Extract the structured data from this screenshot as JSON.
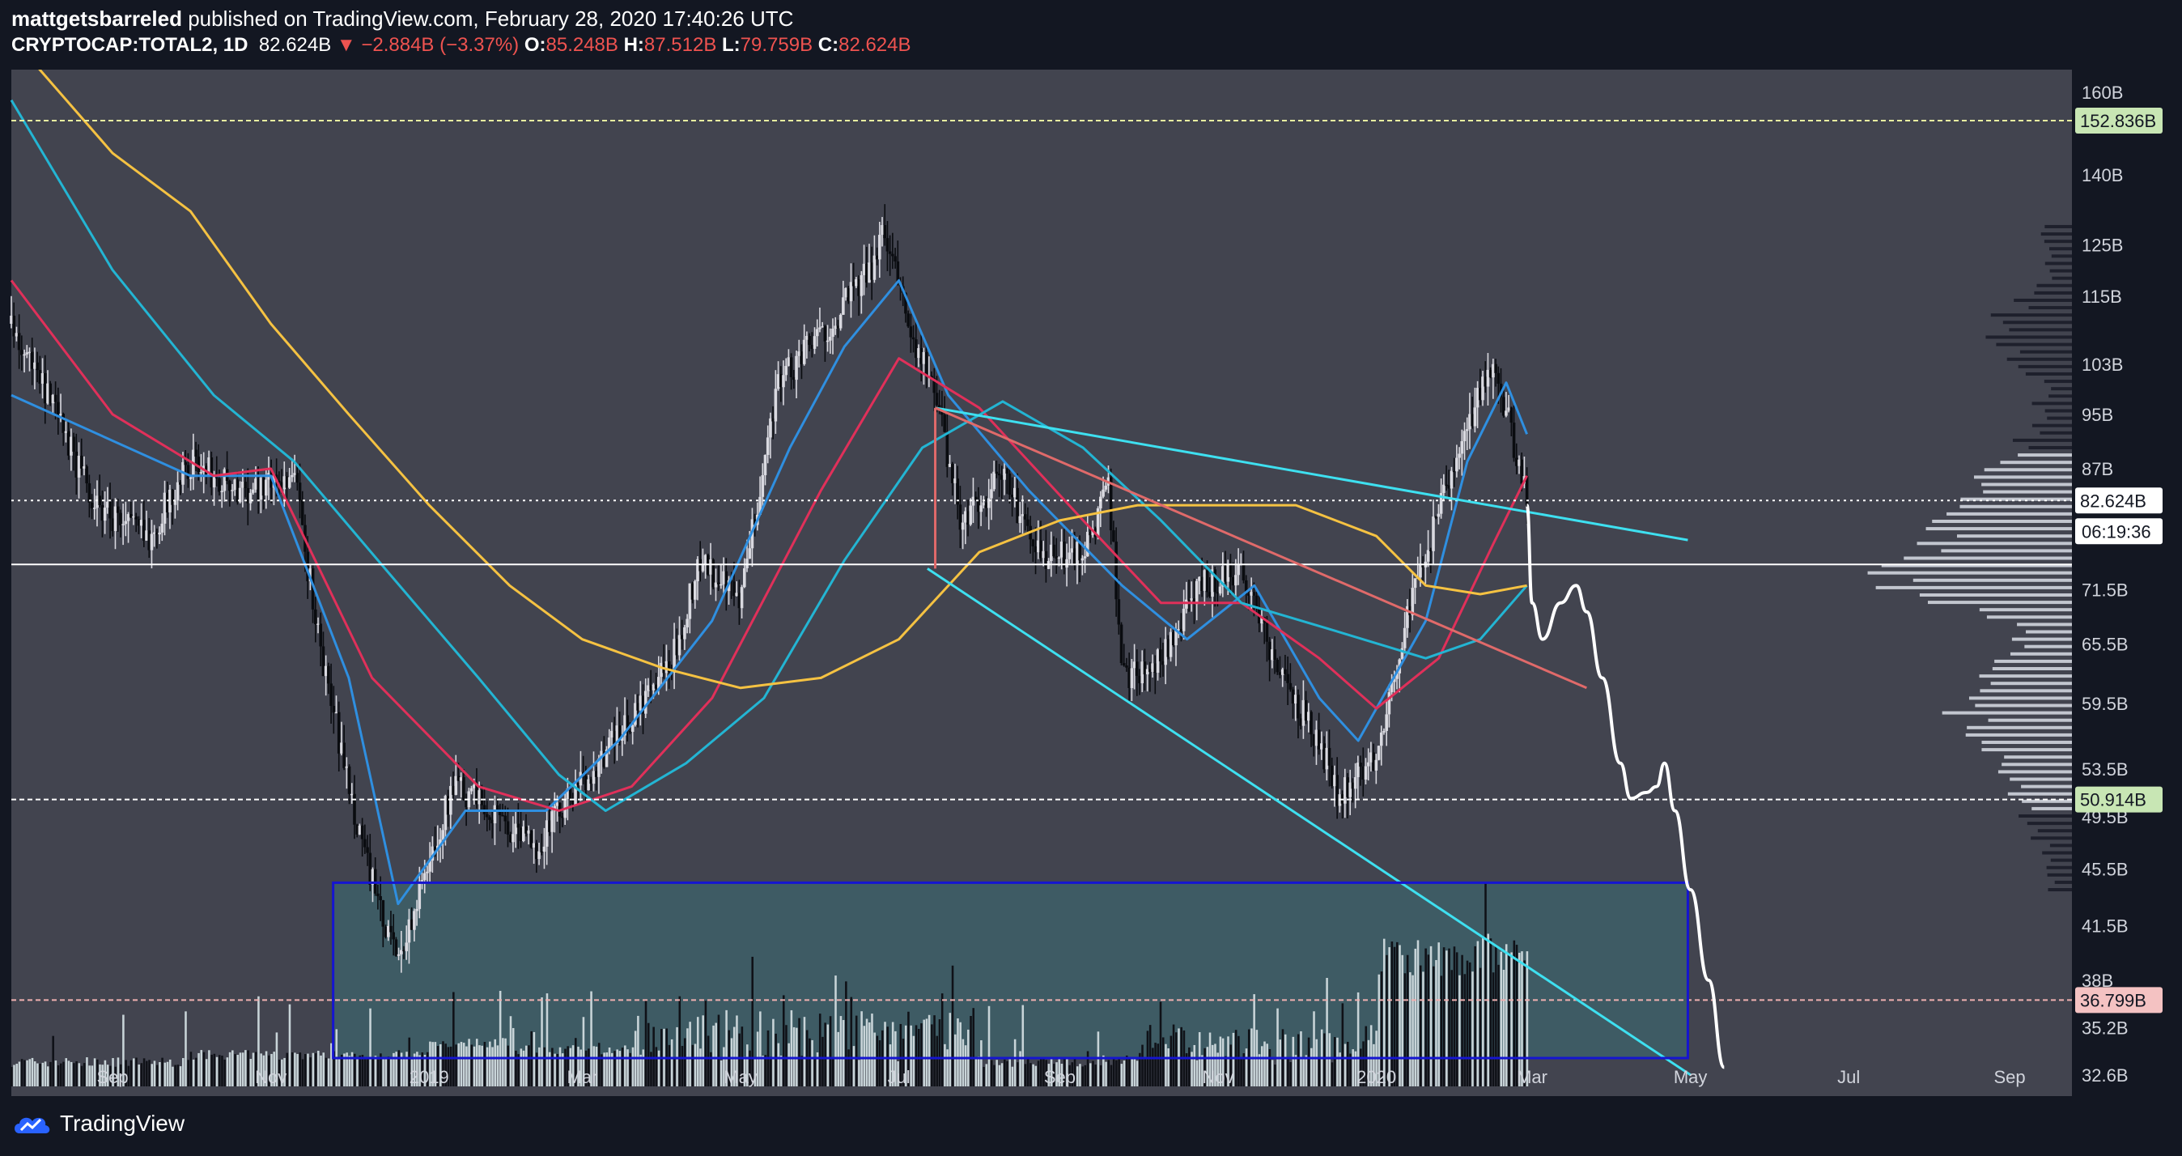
{
  "header": {
    "author": "mattgetsbarreled",
    "published_text": " published on TradingView.com, February 28, 2020 17:40:26 UTC"
  },
  "ohlc": {
    "symbol": "CRYPTOCAP:TOTAL2, 1D",
    "last": "82.624B",
    "change": "▼ −2.884B (−3.37%)",
    "o_label": "O:",
    "o": "85.248B",
    "h_label": "H:",
    "h": "87.512B",
    "l_label": "L:",
    "l": "79.759B",
    "c_label": "C:",
    "c": "82.624B"
  },
  "footer": {
    "brand": "TradingView"
  },
  "colors": {
    "background": "#42444f",
    "panel": "#131722",
    "axis_text": "#d1d4dc",
    "candle_up": "#d9d9e0",
    "candle_down": "#131722",
    "ema_blue": "#2f8fe0",
    "ema_red": "#e0305a",
    "ema_cyan": "#23b5d3",
    "ema_yellow": "#f5c242",
    "trend_cyan": "#3ee0f0",
    "trend_salmon": "#e06a6a",
    "projection": "#ffffff",
    "box_fill": "#3e5e66",
    "box_border": "#1515d0"
  },
  "chart_data": {
    "type": "candlestick",
    "y_scale": "log",
    "y_range": [
      31.5,
      166
    ],
    "x_range": [
      "2018-07-24",
      "2020-09-25"
    ],
    "y_ticks": [
      "160B",
      "140B",
      "125B",
      "115B",
      "103B",
      "95B",
      "87B",
      "71.5B",
      "65.5B",
      "59.5B",
      "53.5B",
      "49.5B",
      "45.5B",
      "41.5B",
      "38B",
      "35.2B",
      "32.6B"
    ],
    "y_tick_values": [
      160,
      140,
      125,
      115,
      103,
      95,
      87,
      71.5,
      65.5,
      59.5,
      53.5,
      49.5,
      45.5,
      41.5,
      38,
      35.2,
      32.6
    ],
    "x_ticks": [
      "Sep",
      "Nov",
      "2019",
      "Mar",
      "May",
      "Jul",
      "Sep",
      "Nov",
      "2020",
      "Mar",
      "May",
      "Jul",
      "Sep"
    ],
    "x_tick_dates": [
      "2018-09-01",
      "2018-11-01",
      "2019-01-01",
      "2019-03-01",
      "2019-05-01",
      "2019-07-01",
      "2019-09-01",
      "2019-11-01",
      "2020-01-01",
      "2020-03-01",
      "2020-05-01",
      "2020-07-01",
      "2020-09-01"
    ],
    "price_key_points": [
      [
        "2018-07-24",
        110
      ],
      [
        "2018-08-10",
        95
      ],
      [
        "2018-08-25",
        82
      ],
      [
        "2018-09-15",
        78
      ],
      [
        "2018-10-01",
        88
      ],
      [
        "2018-10-20",
        84
      ],
      [
        "2018-11-10",
        86
      ],
      [
        "2018-11-20",
        65
      ],
      [
        "2018-12-01",
        52
      ],
      [
        "2018-12-15",
        41
      ],
      [
        "2018-12-22",
        40
      ],
      [
        "2019-01-10",
        52
      ],
      [
        "2019-01-25",
        50
      ],
      [
        "2019-02-10",
        47
      ],
      [
        "2019-02-28",
        52
      ],
      [
        "2019-03-20",
        58
      ],
      [
        "2019-04-05",
        64
      ],
      [
        "2019-04-15",
        75
      ],
      [
        "2019-05-01",
        70
      ],
      [
        "2019-05-15",
        100
      ],
      [
        "2019-06-01",
        108
      ],
      [
        "2019-06-20",
        120
      ],
      [
        "2019-06-26",
        128
      ],
      [
        "2019-07-05",
        110
      ],
      [
        "2019-07-15",
        98
      ],
      [
        "2019-07-25",
        80
      ],
      [
        "2019-08-10",
        86
      ],
      [
        "2019-08-25",
        75
      ],
      [
        "2019-09-10",
        76
      ],
      [
        "2019-09-20",
        84
      ],
      [
        "2019-09-25",
        62
      ],
      [
        "2019-10-10",
        64
      ],
      [
        "2019-10-26",
        72
      ],
      [
        "2019-11-10",
        74
      ],
      [
        "2019-11-25",
        62
      ],
      [
        "2019-12-10",
        56
      ],
      [
        "2019-12-18",
        51
      ],
      [
        "2020-01-01",
        55
      ],
      [
        "2020-01-10",
        65
      ],
      [
        "2020-01-20",
        76
      ],
      [
        "2020-02-01",
        88
      ],
      [
        "2020-02-14",
        103
      ],
      [
        "2020-02-20",
        96
      ],
      [
        "2020-02-28",
        82.6
      ]
    ],
    "price_candle_count": 584,
    "ema_series": [
      {
        "key": "ema_blue",
        "points": [
          [
            "2018-07-24",
            98
          ],
          [
            "2018-10-01",
            86
          ],
          [
            "2018-11-01",
            86
          ],
          [
            "2018-12-01",
            62
          ],
          [
            "2018-12-20",
            43
          ],
          [
            "2019-01-15",
            50
          ],
          [
            "2019-02-15",
            50
          ],
          [
            "2019-03-15",
            56
          ],
          [
            "2019-04-20",
            68
          ],
          [
            "2019-05-20",
            90
          ],
          [
            "2019-06-10",
            106
          ],
          [
            "2019-07-01",
            118
          ],
          [
            "2019-07-20",
            98
          ],
          [
            "2019-08-20",
            84
          ],
          [
            "2019-09-25",
            72
          ],
          [
            "2019-10-20",
            66
          ],
          [
            "2019-11-15",
            72
          ],
          [
            "2019-12-10",
            60
          ],
          [
            "2019-12-25",
            56
          ],
          [
            "2020-01-20",
            68
          ],
          [
            "2020-02-05",
            88
          ],
          [
            "2020-02-20",
            100
          ],
          [
            "2020-02-28",
            92
          ]
        ]
      },
      {
        "key": "ema_red",
        "points": [
          [
            "2018-07-24",
            118
          ],
          [
            "2018-09-01",
            95
          ],
          [
            "2018-10-10",
            86
          ],
          [
            "2018-11-01",
            87
          ],
          [
            "2018-12-10",
            62
          ],
          [
            "2019-01-20",
            52
          ],
          [
            "2019-02-20",
            50
          ],
          [
            "2019-03-20",
            52
          ],
          [
            "2019-04-20",
            60
          ],
          [
            "2019-06-01",
            84
          ],
          [
            "2019-07-01",
            104
          ],
          [
            "2019-08-01",
            96
          ],
          [
            "2019-09-10",
            80
          ],
          [
            "2019-10-10",
            70
          ],
          [
            "2019-11-10",
            70
          ],
          [
            "2019-12-10",
            64
          ],
          [
            "2020-01-01",
            59
          ],
          [
            "2020-01-25",
            64
          ],
          [
            "2020-02-15",
            77
          ],
          [
            "2020-02-28",
            86
          ]
        ]
      },
      {
        "key": "ema_cyan",
        "points": [
          [
            "2018-07-24",
            158
          ],
          [
            "2018-09-01",
            120
          ],
          [
            "2018-10-10",
            98
          ],
          [
            "2018-11-10",
            88
          ],
          [
            "2018-12-15",
            74
          ],
          [
            "2019-01-20",
            62
          ],
          [
            "2019-02-20",
            53
          ],
          [
            "2019-03-10",
            50
          ],
          [
            "2019-04-10",
            54
          ],
          [
            "2019-05-10",
            60
          ],
          [
            "2019-06-10",
            75
          ],
          [
            "2019-07-10",
            90
          ],
          [
            "2019-08-10",
            97
          ],
          [
            "2019-09-10",
            90
          ],
          [
            "2019-10-10",
            80
          ],
          [
            "2019-11-10",
            70
          ],
          [
            "2019-12-15",
            67
          ],
          [
            "2020-01-20",
            64
          ],
          [
            "2020-02-10",
            66
          ],
          [
            "2020-02-28",
            72
          ]
        ]
      },
      {
        "key": "ema_yellow",
        "points": [
          [
            "2018-07-24",
            175
          ],
          [
            "2018-09-01",
            145
          ],
          [
            "2018-10-01",
            132
          ],
          [
            "2018-11-01",
            110
          ],
          [
            "2018-12-01",
            95
          ],
          [
            "2019-01-01",
            82
          ],
          [
            "2019-02-01",
            72
          ],
          [
            "2019-03-01",
            66
          ],
          [
            "2019-04-01",
            63
          ],
          [
            "2019-05-01",
            61
          ],
          [
            "2019-06-01",
            62
          ],
          [
            "2019-07-01",
            66
          ],
          [
            "2019-08-01",
            76
          ],
          [
            "2019-09-01",
            80
          ],
          [
            "2019-10-01",
            82
          ],
          [
            "2019-11-01",
            82
          ],
          [
            "2019-12-01",
            82
          ],
          [
            "2020-01-01",
            78
          ],
          [
            "2020-01-20",
            72
          ],
          [
            "2020-02-10",
            71
          ],
          [
            "2020-02-28",
            72
          ]
        ]
      }
    ],
    "volume_bar_count": 584,
    "volume_unit_note": "volume histogram (relative heights)",
    "horizontal_levels": [
      {
        "label": "152.836B",
        "value": 152.836,
        "style": "dashed",
        "color": "#e8f0a0",
        "tag_bg": "#c8e6b4"
      },
      {
        "label": "82.624B",
        "value": 82.624,
        "style": "dotted",
        "color": "#ffffff",
        "tag_bg": "#ffffff"
      },
      {
        "label": "",
        "value": 74.5,
        "style": "solid",
        "color": "#ffffff",
        "tag_bg": ""
      },
      {
        "label": "50.914B",
        "value": 50.914,
        "style": "dashed",
        "color": "#ffffff",
        "tag_bg": "#c8e6b4"
      },
      {
        "label": "36.799B",
        "value": 36.799,
        "style": "dashed",
        "color": "#f0b0b0",
        "tag_bg": "#f4c2c2"
      }
    ],
    "countdown_label": "06:19:36",
    "trend_lines": [
      {
        "key": "trend_cyan",
        "from": [
          "2019-07-15",
          96
        ],
        "to": [
          "2020-04-30",
          77.5
        ]
      },
      {
        "key": "trend_cyan",
        "from": [
          "2019-07-12",
          74
        ],
        "to": [
          "2020-05-01",
          32.6
        ]
      },
      {
        "key": "trend_salmon",
        "from": [
          "2019-07-15",
          96
        ],
        "to": [
          "2020-03-22",
          61
        ]
      },
      {
        "key": "trend_salmon",
        "from": [
          "2019-07-15",
          96
        ],
        "to": [
          "2019-07-15",
          74
        ]
      }
    ],
    "projection_path": [
      [
        "2020-02-28",
        82
      ],
      [
        "2020-03-01",
        70
      ],
      [
        "2020-03-05",
        66
      ],
      [
        "2020-03-12",
        70
      ],
      [
        "2020-03-18",
        72
      ],
      [
        "2020-03-22",
        69
      ],
      [
        "2020-03-28",
        62
      ],
      [
        "2020-04-04",
        54
      ],
      [
        "2020-04-08",
        51
      ],
      [
        "2020-04-14",
        51.5
      ],
      [
        "2020-04-18",
        52
      ],
      [
        "2020-04-21",
        54
      ],
      [
        "2020-04-25",
        50
      ],
      [
        "2020-05-01",
        44
      ],
      [
        "2020-05-08",
        38
      ],
      [
        "2020-05-14",
        33
      ]
    ],
    "volume_box": {
      "from": "2018-11-25",
      "to": "2020-04-30",
      "top": 44.5,
      "bottom": 33.5
    },
    "volume_profile_note": "visible range volume profile on right side"
  }
}
